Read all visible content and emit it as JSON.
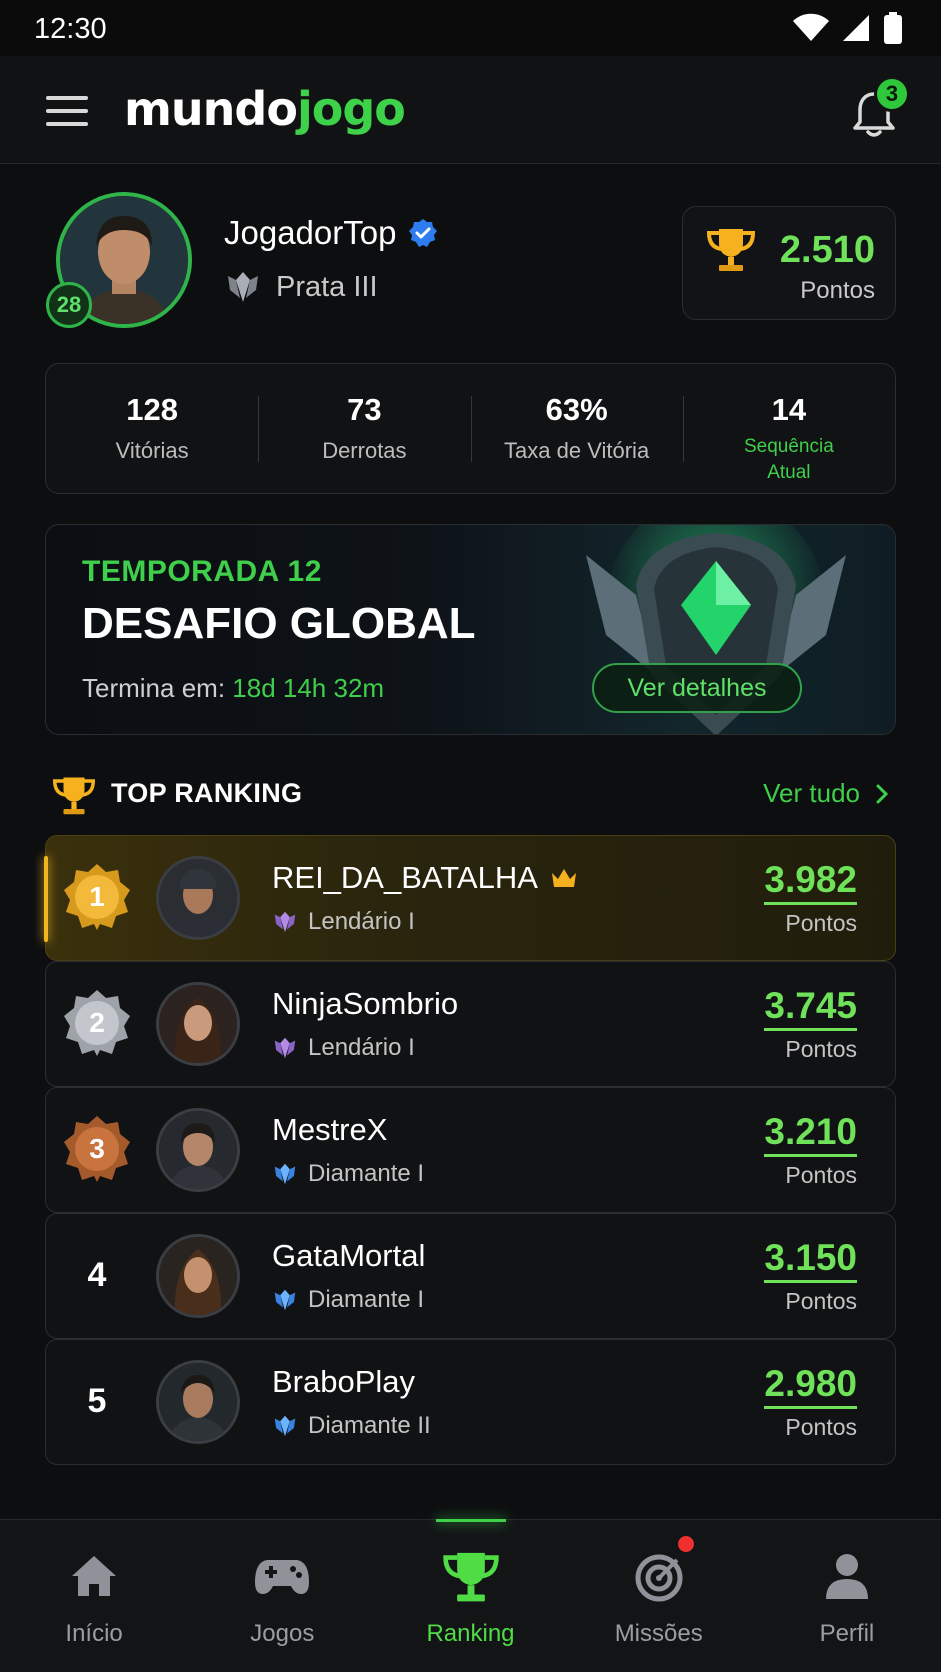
{
  "status_bar": {
    "time": "12:30"
  },
  "header": {
    "logo_part1": "mundo",
    "logo_part2": "jogo",
    "notification_count": "3"
  },
  "profile": {
    "username": "JogadorTop",
    "level": "28",
    "rank": "Prata III",
    "points_value": "2.510",
    "points_label": "Pontos"
  },
  "stats": [
    {
      "value": "128",
      "label": "Vitórias"
    },
    {
      "value": "73",
      "label": "Derrotas"
    },
    {
      "value": "63%",
      "label": "Taxa de Vitória"
    },
    {
      "value": "14",
      "label": "Sequência Atual"
    }
  ],
  "banner": {
    "season": "TEMPORADA 12",
    "title": "DESAFIO GLOBAL",
    "ends_label": "Termina em:",
    "ends_time": "18d 14h 32m",
    "button": "Ver detalhes"
  },
  "ranking": {
    "title": "TOP RANKING",
    "see_all": "Ver tudo",
    "points_label": "Pontos",
    "players": [
      {
        "position": "1",
        "name": "REI_DA_BATALHA",
        "tier": "Lendário I",
        "score": "3.982"
      },
      {
        "position": "2",
        "name": "NinjaSombrio",
        "tier": "Lendário I",
        "score": "3.745"
      },
      {
        "position": "3",
        "name": "MestreX",
        "tier": "Diamante I",
        "score": "3.210"
      },
      {
        "position": "4",
        "name": "GataMortal",
        "tier": "Diamante I",
        "score": "3.150"
      },
      {
        "position": "5",
        "name": "BraboPlay",
        "tier": "Diamante II",
        "score": "2.980"
      }
    ]
  },
  "bottom_nav": [
    {
      "label": "Início",
      "icon": "home-icon"
    },
    {
      "label": "Jogos",
      "icon": "gamepad-icon"
    },
    {
      "label": "Ranking",
      "icon": "trophy-icon",
      "active": true
    },
    {
      "label": "Missões",
      "icon": "target-icon"
    },
    {
      "label": "Perfil",
      "icon": "user-icon"
    }
  ],
  "colors": {
    "accent": "#3fcf4a",
    "background": "#0d0e10",
    "gold": "#f0b520"
  }
}
